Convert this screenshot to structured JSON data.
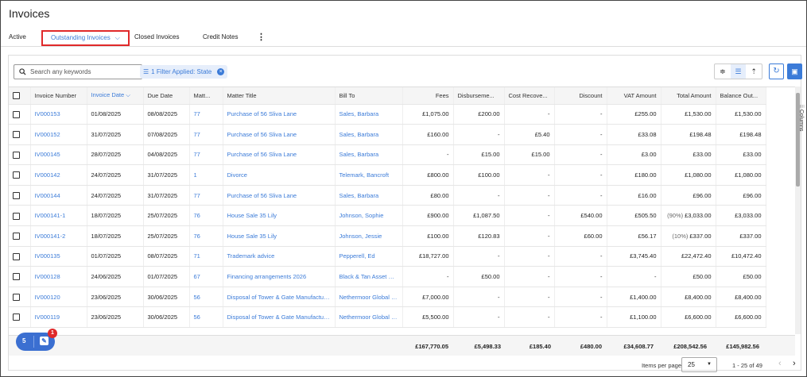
{
  "page": {
    "title": "Invoices"
  },
  "tabs": [
    {
      "label": "Active"
    },
    {
      "label": "Outstanding Invoices"
    },
    {
      "label": "Closed Invoices"
    },
    {
      "label": "Credit Notes"
    }
  ],
  "toolbar": {
    "search_placeholder": "Search any keywords",
    "filter_label": "1 Filter Applied: State",
    "columns_label": "Columns"
  },
  "colors": {
    "accent": "#3b7bd8",
    "highlight_border": "#e0292a",
    "badge": "#e0292a"
  },
  "table": {
    "columns": [
      "Invoice Number",
      "Invoice Date",
      "Due Date",
      "Matt...",
      "Matter Title",
      "Bill To",
      "Fees",
      "Disburseme...",
      "Cost Recove...",
      "Discount",
      "VAT Amount",
      "Total Amount",
      "Balance Out..."
    ],
    "sorted_column": "Invoice Date",
    "rows": [
      {
        "invoice": "IV000153",
        "invoice_date": "01/08/2025",
        "due_date": "08/08/2025",
        "matter": "77",
        "matter_title": "Purchase of 56 Sliva Lane",
        "bill_to": "Sales, Barbara",
        "fees": "£1,075.00",
        "disb": "£200.00",
        "cost": "-",
        "discount": "-",
        "vat": "£255.00",
        "total_pct": "",
        "total": "£1,530.00",
        "balance": "£1,530.00"
      },
      {
        "invoice": "IV000152",
        "invoice_date": "31/07/2025",
        "due_date": "07/08/2025",
        "matter": "77",
        "matter_title": "Purchase of 56 Sliva Lane",
        "bill_to": "Sales, Barbara",
        "fees": "£160.00",
        "disb": "-",
        "cost": "£5.40",
        "discount": "-",
        "vat": "£33.08",
        "total_pct": "",
        "total": "£198.48",
        "balance": "£198.48"
      },
      {
        "invoice": "IV000145",
        "invoice_date": "28/07/2025",
        "due_date": "04/08/2025",
        "matter": "77",
        "matter_title": "Purchase of 56 Sliva Lane",
        "bill_to": "Sales, Barbara",
        "fees": "-",
        "disb": "£15.00",
        "cost": "£15.00",
        "discount": "-",
        "vat": "£3.00",
        "total_pct": "",
        "total": "£33.00",
        "balance": "£33.00"
      },
      {
        "invoice": "IV000142",
        "invoice_date": "24/07/2025",
        "due_date": "31/07/2025",
        "matter": "1",
        "matter_title": "Divorce",
        "bill_to": "Telemark, Bancroft",
        "fees": "£800.00",
        "disb": "£100.00",
        "cost": "-",
        "discount": "-",
        "vat": "£180.00",
        "total_pct": "",
        "total": "£1,080.00",
        "balance": "£1,080.00"
      },
      {
        "invoice": "IV000144",
        "invoice_date": "24/07/2025",
        "due_date": "31/07/2025",
        "matter": "77",
        "matter_title": "Purchase of 56 Sliva Lane",
        "bill_to": "Sales, Barbara",
        "fees": "£80.00",
        "disb": "-",
        "cost": "-",
        "discount": "-",
        "vat": "£16.00",
        "total_pct": "",
        "total": "£96.00",
        "balance": "£96.00"
      },
      {
        "invoice": "IV000141-1",
        "invoice_date": "18/07/2025",
        "due_date": "25/07/2025",
        "matter": "76",
        "matter_title": "House Sale 35 Lily",
        "bill_to": "Johnson, Sophie",
        "fees": "£900.00",
        "disb": "£1,087.50",
        "cost": "-",
        "discount": "£540.00",
        "vat": "£505.50",
        "total_pct": "(90%)",
        "total": "£3,033.00",
        "balance": "£3,033.00"
      },
      {
        "invoice": "IV000141-2",
        "invoice_date": "18/07/2025",
        "due_date": "25/07/2025",
        "matter": "76",
        "matter_title": "House Sale 35 Lily",
        "bill_to": "Johnson, Jessie",
        "fees": "£100.00",
        "disb": "£120.83",
        "cost": "-",
        "discount": "£60.00",
        "vat": "£56.17",
        "total_pct": "(10%)",
        "total": "£337.00",
        "balance": "£337.00"
      },
      {
        "invoice": "IV000135",
        "invoice_date": "01/07/2025",
        "due_date": "08/07/2025",
        "matter": "71",
        "matter_title": "Trademark advice",
        "bill_to": "Pepperell, Ed",
        "fees": "£18,727.00",
        "disb": "-",
        "cost": "-",
        "discount": "-",
        "vat": "£3,745.40",
        "total_pct": "",
        "total": "£22,472.40",
        "balance": "£10,472.40"
      },
      {
        "invoice": "IV000128",
        "invoice_date": "24/06/2025",
        "due_date": "01/07/2025",
        "matter": "67",
        "matter_title": "Financing arrangements 2026",
        "bill_to": "Black & Tan Asset M...",
        "fees": "-",
        "disb": "£50.00",
        "cost": "-",
        "discount": "-",
        "vat": "-",
        "total_pct": "",
        "total": "£50.00",
        "balance": "£50.00"
      },
      {
        "invoice": "IV000120",
        "invoice_date": "23/06/2025",
        "due_date": "30/06/2025",
        "matter": "56",
        "matter_title": "Disposal of Tower & Gate Manufacturing",
        "bill_to": "Nethermoor Global Ltd",
        "fees": "£7,000.00",
        "disb": "-",
        "cost": "-",
        "discount": "-",
        "vat": "£1,400.00",
        "total_pct": "",
        "total": "£8,400.00",
        "balance": "£8,400.00"
      },
      {
        "invoice": "IV000119",
        "invoice_date": "23/06/2025",
        "due_date": "30/06/2025",
        "matter": "56",
        "matter_title": "Disposal of Tower & Gate Manufacturing",
        "bill_to": "Nethermoor Global Ltd",
        "fees": "£5,500.00",
        "disb": "-",
        "cost": "-",
        "discount": "-",
        "vat": "£1,100.00",
        "total_pct": "",
        "total": "£6,600.00",
        "balance": "£6,600.00"
      }
    ],
    "totals": {
      "fees": "£167,770.05",
      "disb": "£5,498.33",
      "cost": "£185.40",
      "discount": "£480.00",
      "vat": "£34,608.77",
      "total": "£208,542.56",
      "balance": "£145,982.56"
    }
  },
  "pagination": {
    "items_per_page_label": "Items per page",
    "items_per_page": "25",
    "range": "1 - 25 of 49"
  },
  "chat_widget": {
    "count": "5",
    "badge": "1"
  }
}
